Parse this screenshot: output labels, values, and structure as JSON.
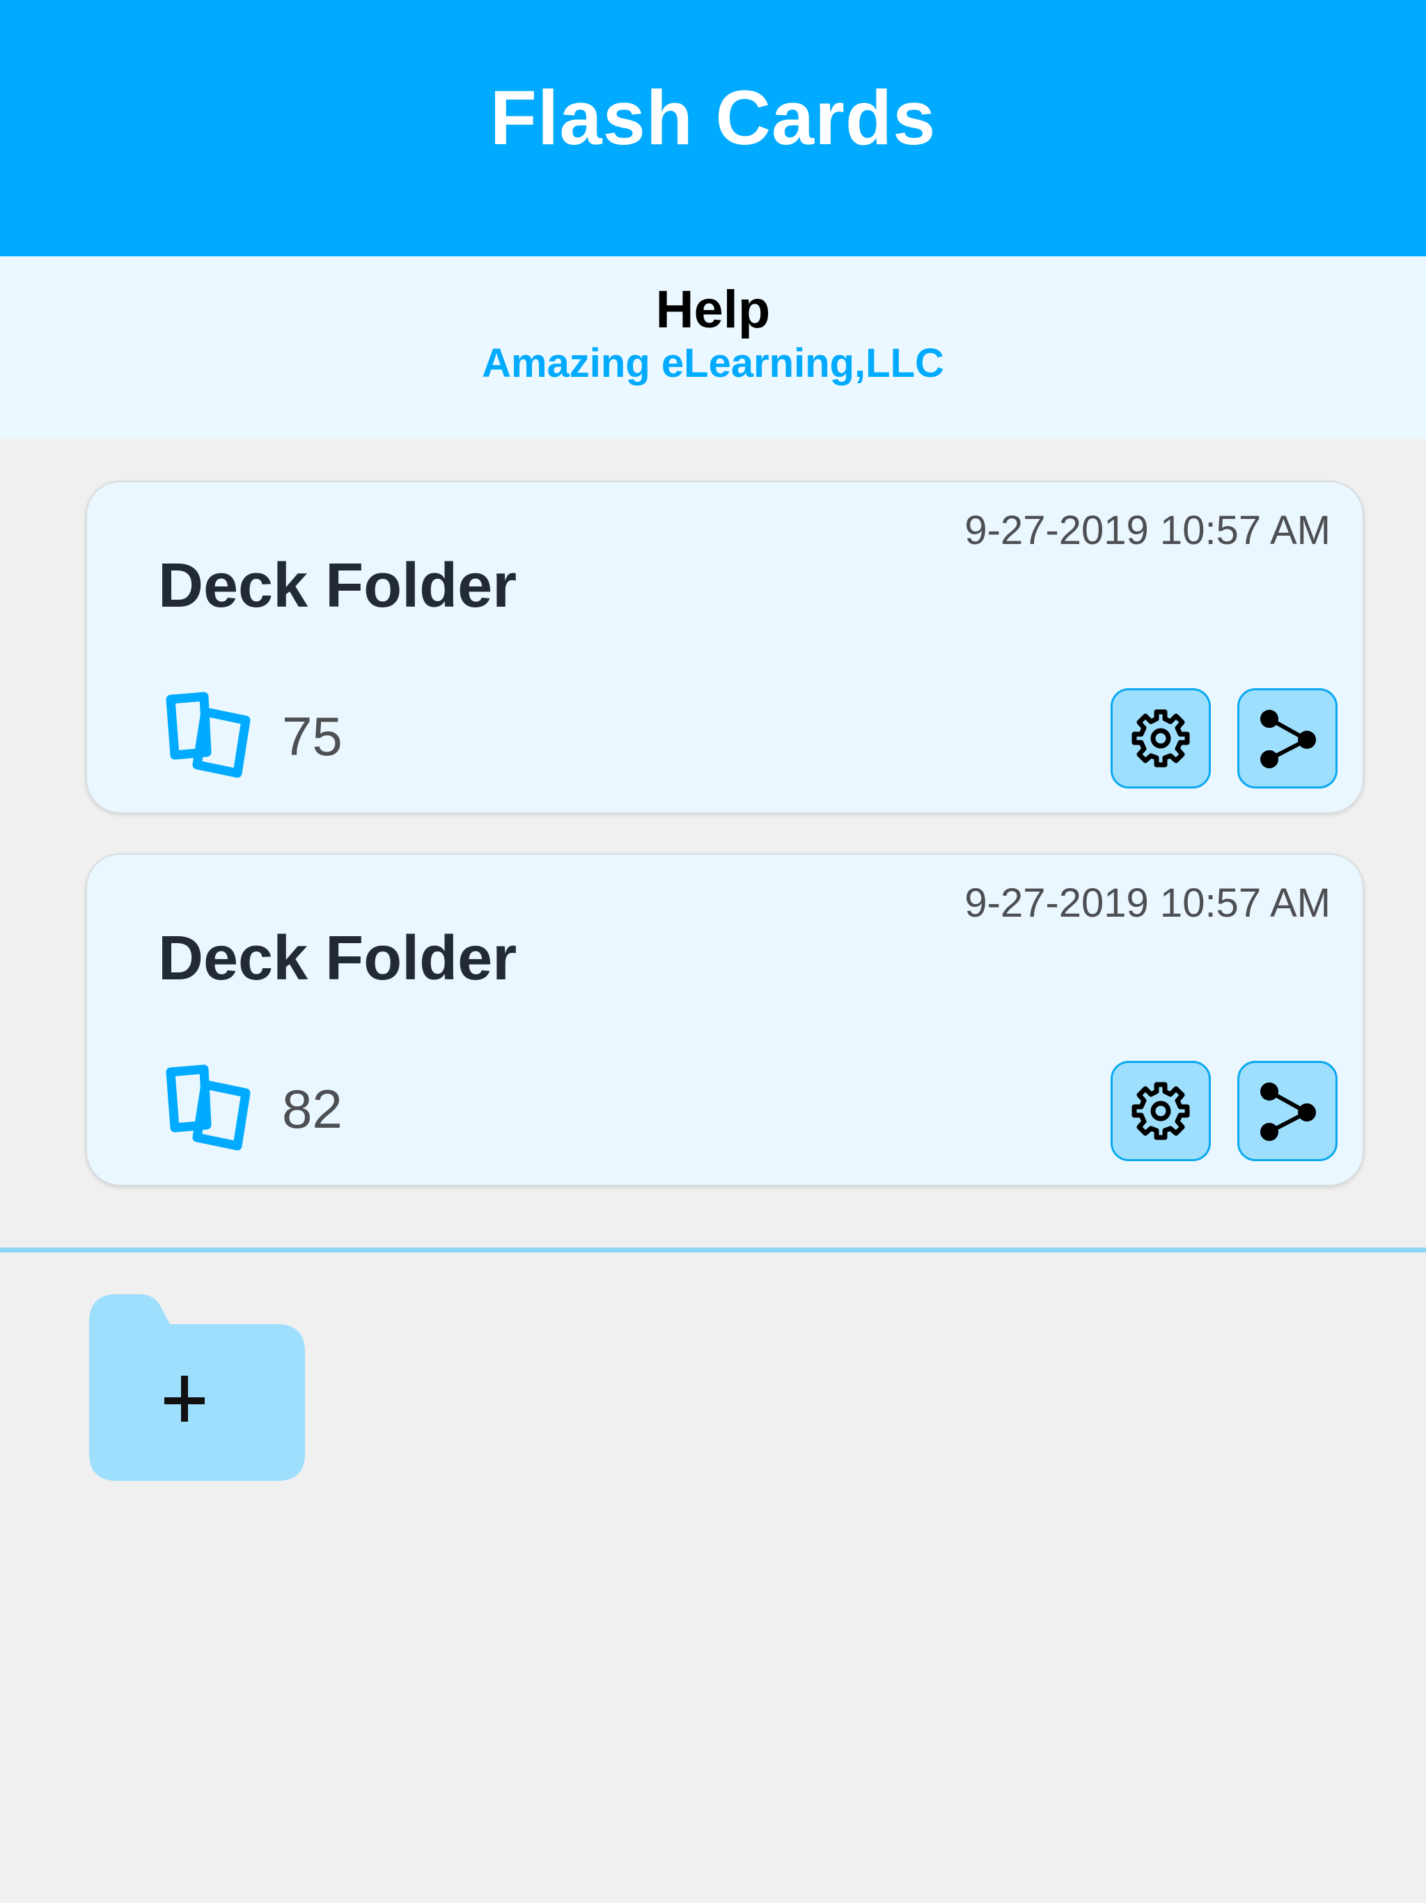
{
  "header": {
    "title": "Flash Cards"
  },
  "help": {
    "title": "Help",
    "company": "Amazing eLearning,LLC"
  },
  "decks": [
    {
      "title": "Deck Folder",
      "date": "9-27-2019 10:57 AM",
      "count": "75",
      "count_icon": "cards-icon",
      "settings_icon": "gear-icon",
      "share_icon": "share-icon"
    },
    {
      "title": "Deck Folder",
      "date": "9-27-2019 10:57 AM",
      "count": "82",
      "count_icon": "cards-icon",
      "settings_icon": "gear-icon",
      "share_icon": "share-icon"
    }
  ],
  "add_folder": {
    "icon": "folder-plus-icon"
  },
  "colors": {
    "accent": "#00aaff",
    "help_band_bg": "#ebf8ff",
    "card_bg": "#eaf7fe",
    "button_bg": "#9edffd",
    "button_border": "#0aa9f2",
    "divider": "#8ed6f5",
    "folder": "#9edffd",
    "page_bg": "#f0f0f0"
  }
}
